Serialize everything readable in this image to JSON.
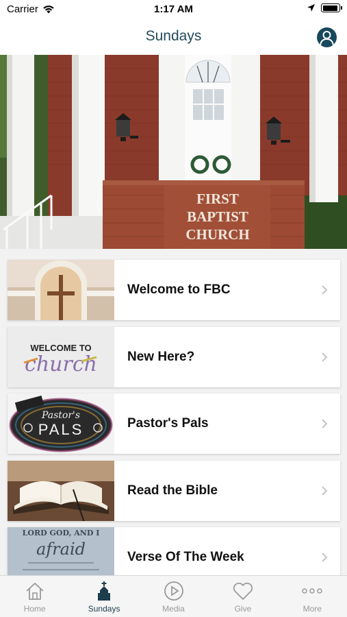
{
  "status_bar": {
    "carrier": "Carrier",
    "time": "1:17 AM",
    "battery_level": 0.95
  },
  "nav": {
    "title": "Sundays",
    "profile_icon": "profile-icon"
  },
  "hero": {
    "sign_lines": [
      "FIRST",
      "BAPTIST",
      "CHURCH"
    ]
  },
  "items": [
    {
      "label": "Welcome to FBC",
      "thumb": "altar-cross-thumbnail"
    },
    {
      "label": "New Here?",
      "thumb": "welcome-to-church-thumbnail",
      "thumb_text_1": "WELCOME TO",
      "thumb_text_2": "church"
    },
    {
      "label": "Pastor's Pals",
      "thumb": "pastors-pals-thumbnail",
      "thumb_text_1": "Pastor's",
      "thumb_text_2": "PALS"
    },
    {
      "label": "Read the Bible",
      "thumb": "open-bible-thumbnail"
    },
    {
      "label": "Verse Of The Week",
      "thumb": "verse-thumbnail",
      "thumb_text_1": "LORD GOD, AND I",
      "thumb_text_2": "afraid"
    }
  ],
  "tabs": [
    {
      "label": "Home",
      "icon": "home-icon",
      "active": false
    },
    {
      "label": "Sundays",
      "icon": "church-icon",
      "active": true
    },
    {
      "label": "Media",
      "icon": "play-icon",
      "active": false
    },
    {
      "label": "Give",
      "icon": "heart-icon",
      "active": false
    },
    {
      "label": "More",
      "icon": "more-dots-icon",
      "active": false
    }
  ],
  "colors": {
    "accent": "#244a5a",
    "tab_inactive": "#9a9a9a",
    "brick": "#8e3b2a"
  }
}
